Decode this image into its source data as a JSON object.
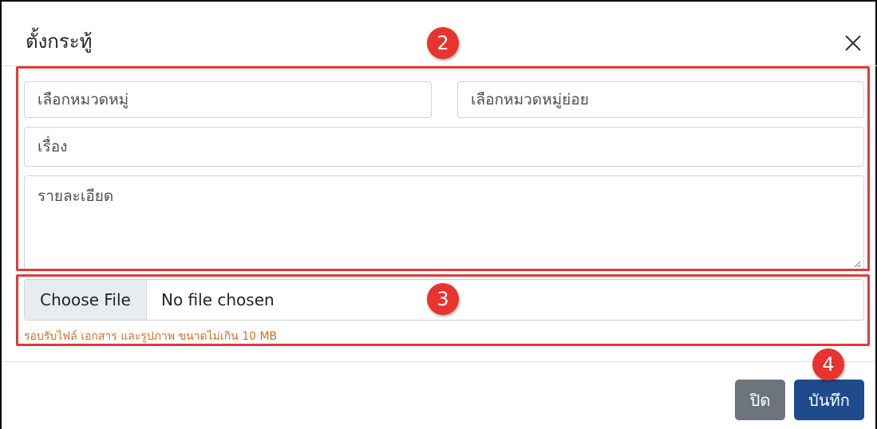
{
  "modal": {
    "title": "ตั้งกระทู้",
    "close_icon": "close-icon"
  },
  "form": {
    "category_placeholder": "เลือกหมวดหมู่",
    "subcategory_placeholder": "เลือกหมวดหมู่ย่อย",
    "subject_placeholder": "เรื่อง",
    "detail_placeholder": "รายละเอียด"
  },
  "file_input": {
    "button_label": "Choose File",
    "status_text": "No file chosen",
    "hint": "รอบรับไฟล์ เอกสาร และรูปภาพ ขนาดไม่เกิน 10 MB"
  },
  "footer": {
    "close_label": "ปิด",
    "save_label": "บันทึก"
  },
  "annotations": {
    "badges": [
      "2",
      "3",
      "4"
    ],
    "highlight_color": "#e03a3a",
    "badge_color": "#e8332f"
  },
  "colors": {
    "primary": "#1f4a8c",
    "secondary": "#6c757d",
    "hint": "#e06c1c"
  }
}
